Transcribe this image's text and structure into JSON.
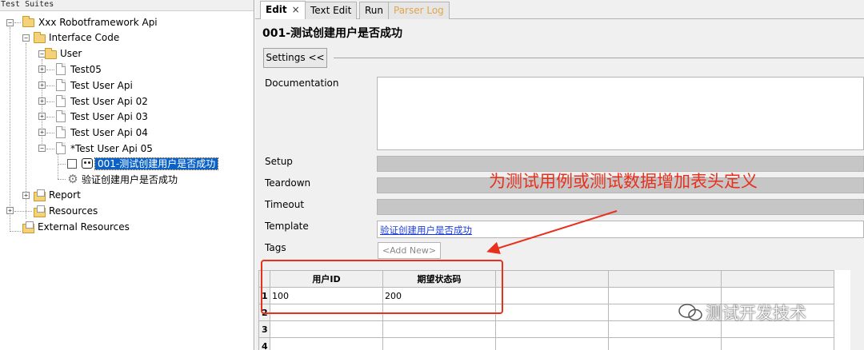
{
  "tree": {
    "title": "Test Suites",
    "nodes": {
      "root": "Xxx Robotframework Api",
      "interface_code": "Interface Code",
      "user": "User",
      "test05": "Test05",
      "test_user_api": "Test User Api",
      "test_user_api_02": "Test User Api 02",
      "test_user_api_03": "Test User Api 03",
      "test_user_api_04": "Test User Api 04",
      "test_user_api_05": "*Test User Api 05",
      "test_case_selected": "001-测试创建用户是否成功",
      "keyword": "验证创建用户是否成功",
      "report": "Report",
      "resources": "Resources",
      "external_resources": "External Resources"
    },
    "expander_plus": "+",
    "expander_minus": "−"
  },
  "tabs": {
    "edit": "Edit",
    "edit_close": "×",
    "text_edit": "Text Edit",
    "run": "Run",
    "parser_log": "Parser Log"
  },
  "editor": {
    "title": "001-测试创建用户是否成功",
    "settings_button": "Settings <<",
    "documentation_label": "Documentation",
    "setup_label": "Setup",
    "teardown_label": "Teardown",
    "timeout_label": "Timeout",
    "template_label": "Template",
    "template_value": "验证创建用户是否成功",
    "tags_label": "Tags",
    "tags_placeholder": "<Add New>"
  },
  "grid": {
    "headers": [
      "用户ID",
      "期望状态码",
      "",
      "",
      ""
    ],
    "rows": [
      {
        "num": "1",
        "cells": [
          "100",
          "200",
          "",
          "",
          ""
        ]
      },
      {
        "num": "2",
        "cells": [
          "",
          "",
          "",
          "",
          ""
        ]
      },
      {
        "num": "3",
        "cells": [
          "",
          "",
          "",
          "",
          ""
        ]
      },
      {
        "num": "4",
        "cells": [
          "",
          "",
          "",
          "",
          ""
        ]
      }
    ]
  },
  "annotation": {
    "text": "为测试用例或测试数据增加表头定义",
    "color": "#e8301c"
  },
  "watermark": {
    "text": "测试开发技术"
  },
  "colors": {
    "selection": "#0a62c9",
    "link": "#1a3bdb",
    "parser_tab": "#e0a64d"
  }
}
